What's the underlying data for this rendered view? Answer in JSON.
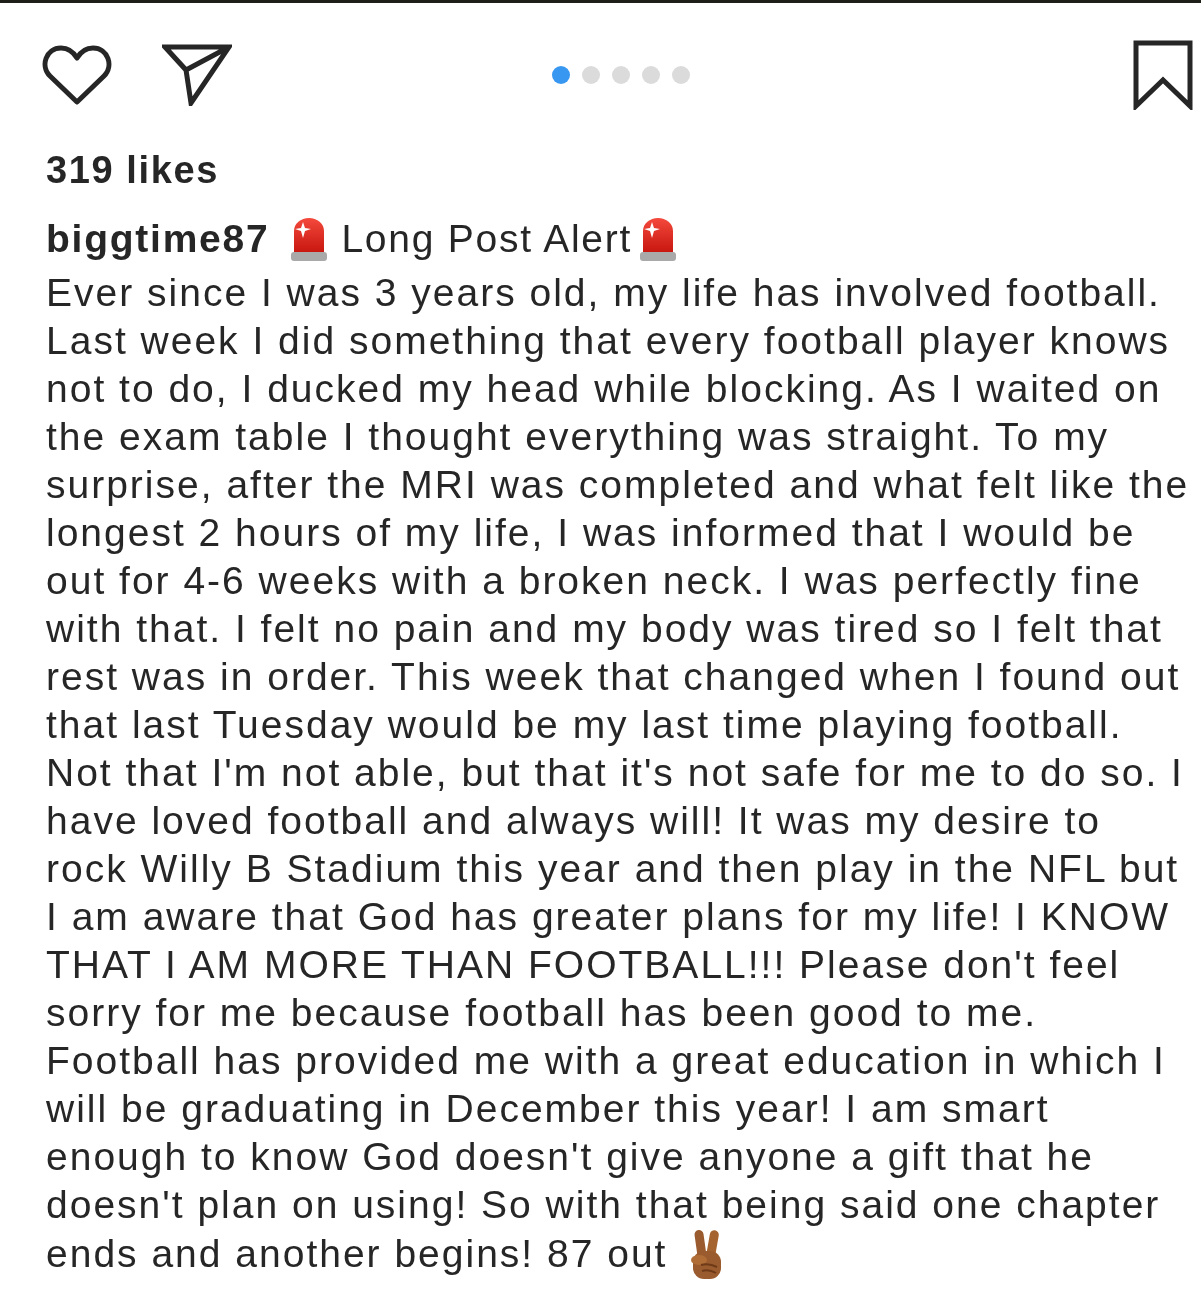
{
  "actions": {
    "liked": false,
    "saved": false
  },
  "carousel": {
    "dots": [
      {
        "selected": true
      },
      {
        "selected": false
      },
      {
        "selected": false
      },
      {
        "selected": false
      },
      {
        "selected": false
      }
    ]
  },
  "likes": "319 likes",
  "caption": {
    "username": "biggtime87",
    "headline": "Long Post Alert",
    "body": "Ever since I was 3 years old, my life has involved football. Last week I did something that every football player knows not to do, I ducked my head while blocking. As I waited on the exam table I thought everything was straight. To my surprise, after the MRI was completed and what felt like the longest 2 hours of my life, I was informed that I would be out for 4-6 weeks with a broken neck. I was perfectly fine with that. I felt no pain and my body was tired so I felt that rest was in order. This week that changed when I found out that last Tuesday would be my last time playing football. Not that I'm not able, but that it's not safe for me to do so. I have loved football and always will! It was my desire to rock Willy B Stadium this year and then play in the NFL but I am aware that God has greater plans for my life! I KNOW THAT I AM MORE THAN FOOTBALL!!! Please don't feel sorry for me because football has been good to me. Football has provided me with a great education in which I will be graduating in December this year! I am smart enough to know God doesn't give anyone a gift that he doesn't plan on using! So with that being said one chapter ends and another begins! 87 out"
  }
}
